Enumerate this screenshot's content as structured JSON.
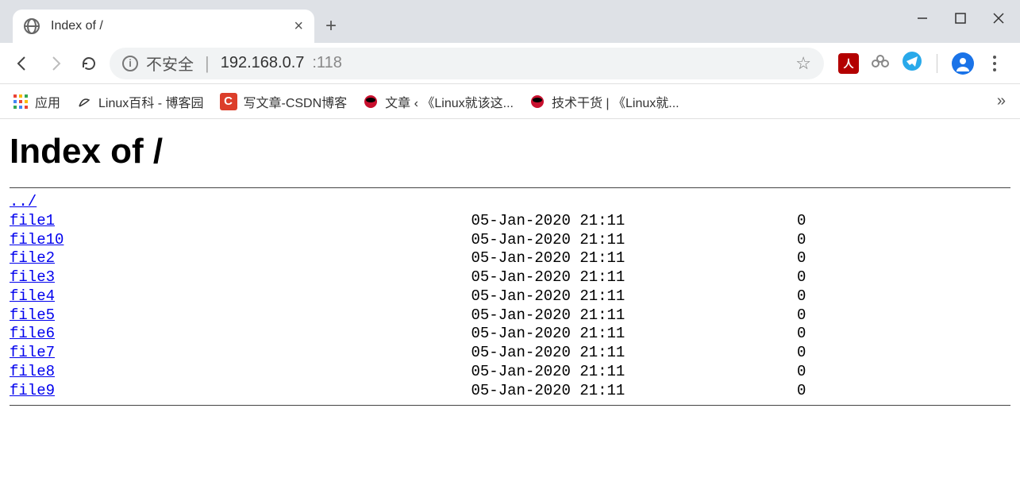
{
  "tab": {
    "title": "Index of /"
  },
  "url": {
    "insecure": "不安全",
    "host": "192.168.0.7",
    "port": ":118"
  },
  "bookmarks": {
    "apps": "应用",
    "b1": "Linux百科 - 博客园",
    "b2": "写文章-CSDN博客",
    "b3": "文章 ‹ 《Linux就该这...",
    "b4": "技术干货 | 《Linux就..."
  },
  "page": {
    "heading": "Index of /",
    "parent": "../",
    "files": [
      {
        "name": "file1",
        "date": "05-Jan-2020 21:11",
        "size": "0"
      },
      {
        "name": "file10",
        "date": "05-Jan-2020 21:11",
        "size": "0"
      },
      {
        "name": "file2",
        "date": "05-Jan-2020 21:11",
        "size": "0"
      },
      {
        "name": "file3",
        "date": "05-Jan-2020 21:11",
        "size": "0"
      },
      {
        "name": "file4",
        "date": "05-Jan-2020 21:11",
        "size": "0"
      },
      {
        "name": "file5",
        "date": "05-Jan-2020 21:11",
        "size": "0"
      },
      {
        "name": "file6",
        "date": "05-Jan-2020 21:11",
        "size": "0"
      },
      {
        "name": "file7",
        "date": "05-Jan-2020 21:11",
        "size": "0"
      },
      {
        "name": "file8",
        "date": "05-Jan-2020 21:11",
        "size": "0"
      },
      {
        "name": "file9",
        "date": "05-Jan-2020 21:11",
        "size": "0"
      }
    ]
  }
}
